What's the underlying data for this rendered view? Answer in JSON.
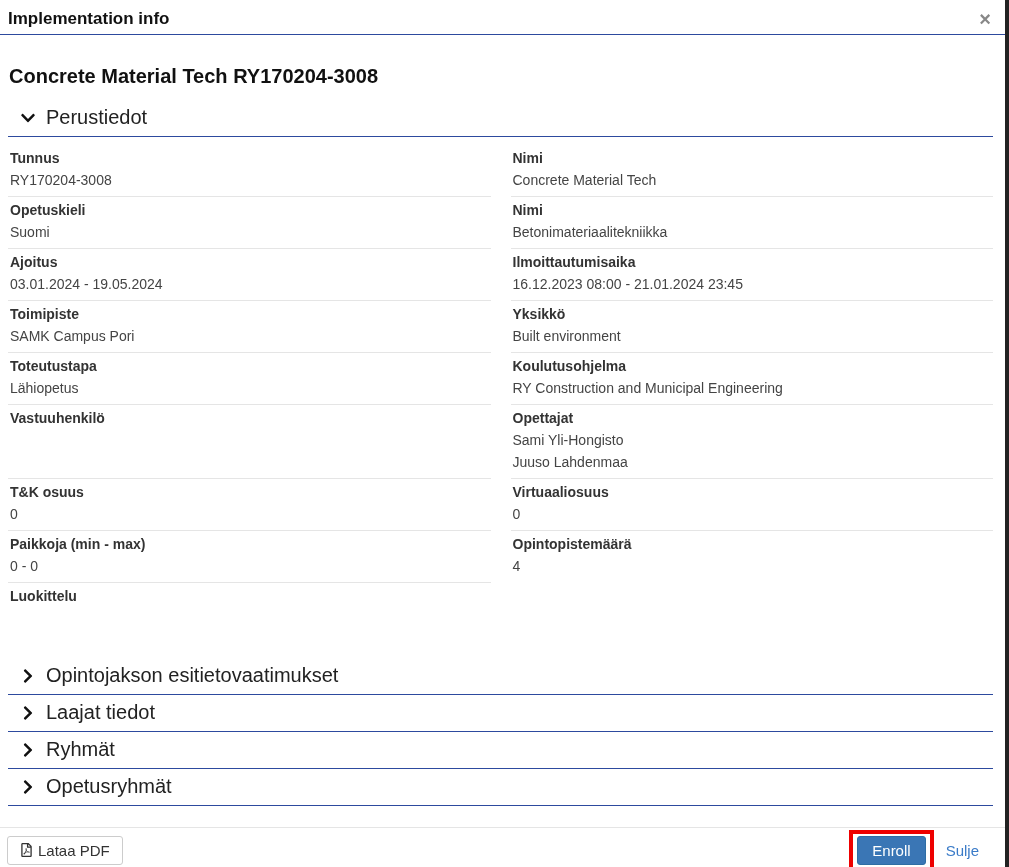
{
  "window": {
    "title": "Implementation info",
    "close": "×"
  },
  "heading": "Concrete Material Tech RY170204-3008",
  "sections": [
    {
      "title": "Perustiedot",
      "expanded": true,
      "rows": [
        {
          "left": {
            "label": "Tunnus",
            "values": [
              "RY170204-3008"
            ]
          },
          "right": {
            "label": "Nimi",
            "values": [
              "Concrete Material Tech"
            ]
          }
        },
        {
          "left": {
            "label": "Opetuskieli",
            "values": [
              "Suomi"
            ]
          },
          "right": {
            "label": "Nimi",
            "values": [
              "Betonimateriaalitekniikka"
            ]
          }
        },
        {
          "left": {
            "label": "Ajoitus",
            "values": [
              "03.01.2024 - 19.05.2024"
            ]
          },
          "right": {
            "label": "Ilmoittautumisaika",
            "values": [
              "16.12.2023 08:00 - 21.01.2024 23:45"
            ]
          }
        },
        {
          "left": {
            "label": "Toimipiste",
            "values": [
              "SAMK Campus Pori"
            ]
          },
          "right": {
            "label": "Yksikkö",
            "values": [
              "Built environment"
            ]
          }
        },
        {
          "left": {
            "label": "Toteutustapa",
            "values": [
              "Lähiopetus"
            ]
          },
          "right": {
            "label": "Koulutusohjelma",
            "values": [
              "RY Construction and Municipal Engineering"
            ]
          }
        },
        {
          "left": {
            "label": "Vastuuhenkilö"
          },
          "right": {
            "label": "Opettajat",
            "values": [
              "Sami Yli-Hongisto",
              "Juuso Lahdenmaa"
            ]
          }
        },
        {
          "left": {
            "label": "T&K osuus",
            "values": [
              "0"
            ]
          },
          "right": {
            "label": "Virtuaaliosuus",
            "values": [
              "0"
            ]
          }
        },
        {
          "left": {
            "label": "Paikkoja (min - max)",
            "values": [
              "0 - 0"
            ]
          },
          "right": {
            "label": "Opintopistemäärä",
            "values": [
              "4"
            ]
          }
        },
        {
          "left": {
            "label": "Luokittelu"
          }
        }
      ]
    },
    {
      "title": "Opintojakson esitietovaatimukset",
      "expanded": false
    },
    {
      "title": "Laajat tiedot",
      "expanded": false
    },
    {
      "title": "Ryhmät",
      "expanded": false
    },
    {
      "title": "Opetusryhmät",
      "expanded": false
    }
  ],
  "footer": {
    "pdf_button": "Lataa PDF",
    "enroll_button": {
      "label": "Enroll",
      "highlighted": true
    },
    "close_link": "Sulje"
  }
}
